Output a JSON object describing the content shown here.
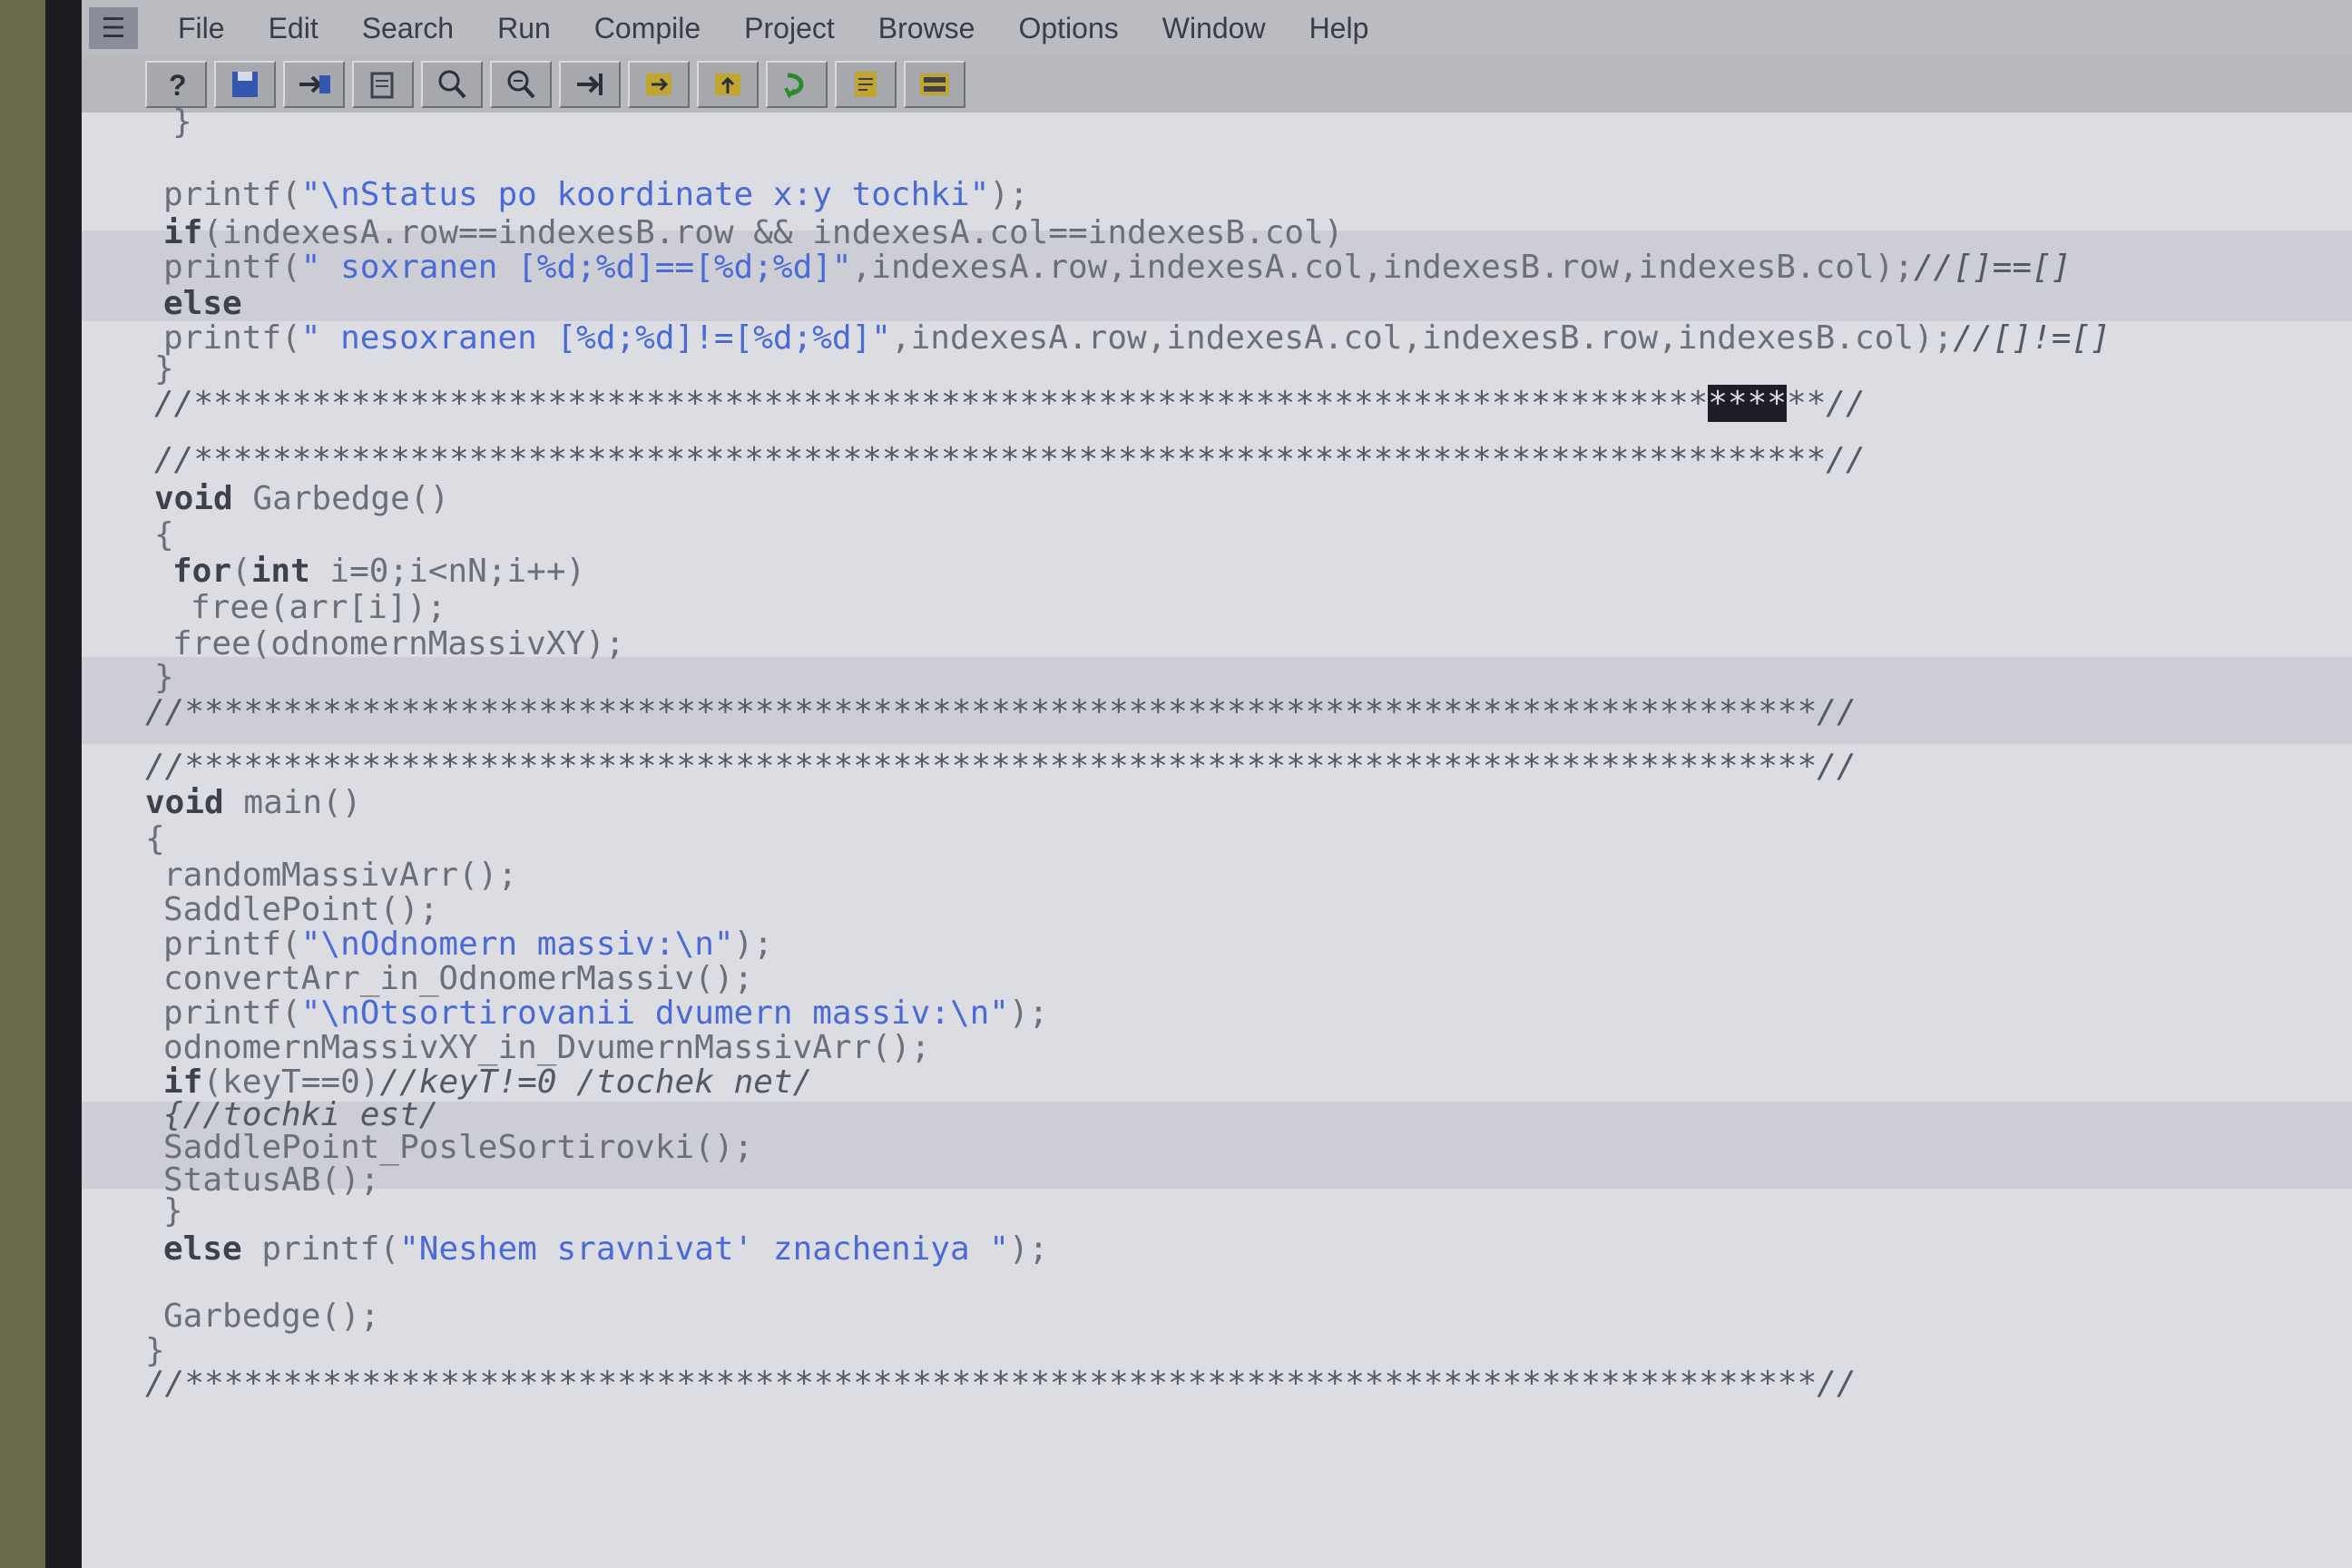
{
  "menu": {
    "items": [
      "File",
      "Edit",
      "Search",
      "Run",
      "Compile",
      "Project",
      "Browse",
      "Options",
      "Window",
      "Help"
    ]
  },
  "toolbar": {
    "buttons": [
      "help-icon",
      "save-icon",
      "save-all-icon",
      "open-icon",
      "search-icon",
      "search-again-icon",
      "step-over-icon",
      "trace-into-icon",
      "go-to-cursor-icon",
      "run-icon",
      "compile-icon",
      "make-icon"
    ]
  },
  "code": {
    "line0": "}",
    "line1_a": "printf(",
    "line1_s": "\"\\nStatus po koordinate x:y tochki\"",
    "line1_b": ");",
    "line2_kw": "if",
    "line2_b": "(indexesA.row==indexesB.row && indexesA.col==indexesB.col)",
    "line3_a": "printf(",
    "line3_s": "\" soxranen [%d;%d]==[%d;%d]\"",
    "line3_b": ",indexesA.row,indexesA.col,indexesB.row,indexesB.col);",
    "line3_c": "//[]==[]",
    "line4_kw": "else",
    "line5_a": "printf(",
    "line5_s": "\" nesoxranen [%d;%d]!=[%d;%d]\"",
    "line5_b": ",indexesA.row,indexesA.col,indexesB.row,indexesB.col);",
    "line5_c": "//[]!=[]",
    "line6": "}",
    "sep1_a": "//*****************************************************************************",
    "sep1_sel": "****",
    "sep1_b": "**//",
    "sep2": "//***********************************************************************************//",
    "garb_kw": "void",
    "garb_name": "Garbedge()",
    "brace_open": "{",
    "for_kw": "for",
    "for_a": "(",
    "for_kw2": "int",
    "for_b": " i=0;i<nN;i++)",
    "free1": "free(arr[i]);",
    "free2": "free(odnomernMassivXY);",
    "brace_close": "}",
    "sep3": "//***********************************************************************************//",
    "sep4": "//***********************************************************************************//",
    "main_kw": "void",
    "main_name": "main()",
    "m1": "randomMassivArr();",
    "m2": "SaddlePoint();",
    "m3_a": "printf(",
    "m3_s": "\"\\nOdnomern massiv:\\n\"",
    "m3_b": ");",
    "m4": "convertArr_in_OdnomerMassiv();",
    "m5_a": "printf(",
    "m5_s": "\"\\nOtsortirovanii dvumern massiv:\\n\"",
    "m5_b": ");",
    "m6": "odnomernMassivXY_in_DvumernMassivArr();",
    "m7_kw": "if",
    "m7_a": "(keyT==0)",
    "m7_c": "//keyT!=0 /tochek net/",
    "m8": "{//tochki est/",
    "m9": "SaddlePoint_PosleSortirovki();",
    "m10": "StatusAB();",
    "m11": "}",
    "m12_kw": "else",
    "m12_a": " printf(",
    "m12_s": "\"Neshem sravnivat' znacheniya \"",
    "m12_b": ");",
    "m13": "Garbedge();",
    "m14": "}",
    "sep5": "//***********************************************************************************//"
  }
}
